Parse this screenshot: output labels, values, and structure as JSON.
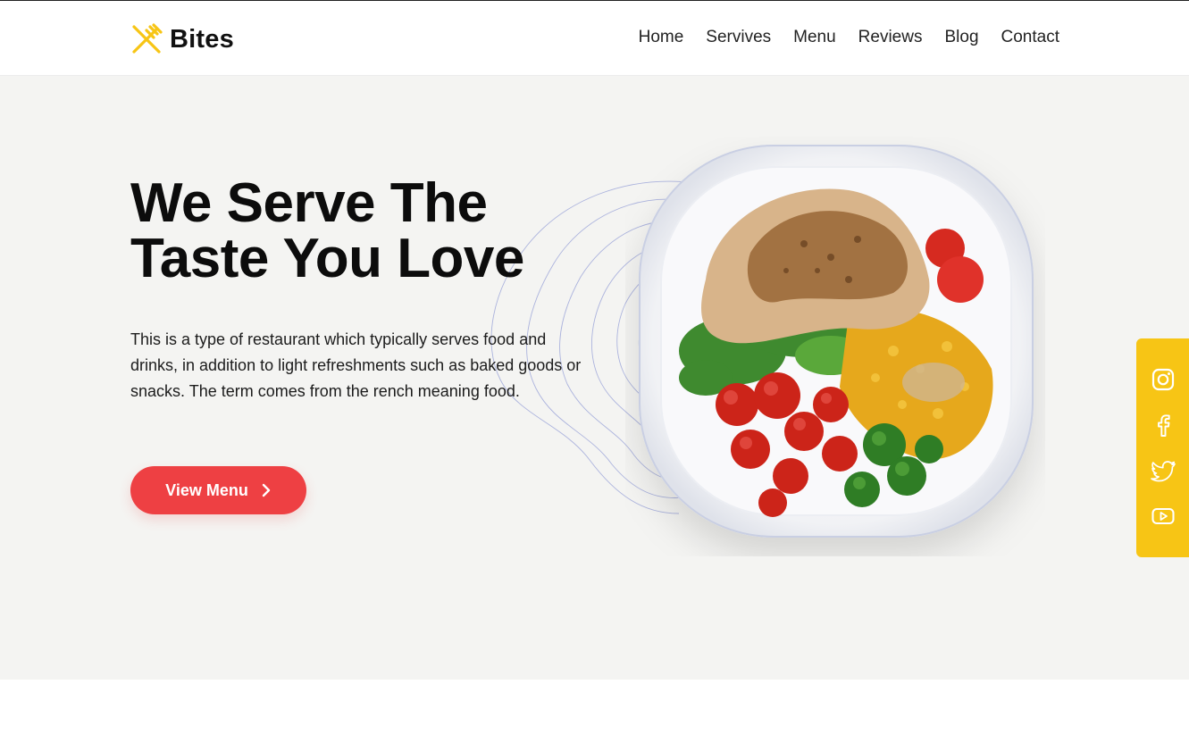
{
  "brand": {
    "name": "Bites",
    "logo_icon": "fork-spoon-icon",
    "accent": "#f7c515"
  },
  "nav": {
    "items": [
      "Home",
      "Servives",
      "Menu",
      "Reviews",
      "Blog",
      "Contact"
    ]
  },
  "hero": {
    "title_line1": "We Serve The",
    "title_line2": "Taste You Love",
    "description": "This is a type of restaurant which typically serves food and drinks, in addition to light refreshments such as baked goods or snacks. The term comes from the rench meaning food.",
    "cta_label": "View Menu",
    "cta_icon": "chevron-right-icon",
    "cta_color": "#ee4043",
    "image": "food-plate-image",
    "background": "#f4f4f2"
  },
  "social": {
    "background": "#f7c515",
    "icons": [
      "instagram-icon",
      "facebook-icon",
      "twitter-icon",
      "youtube-icon"
    ]
  }
}
